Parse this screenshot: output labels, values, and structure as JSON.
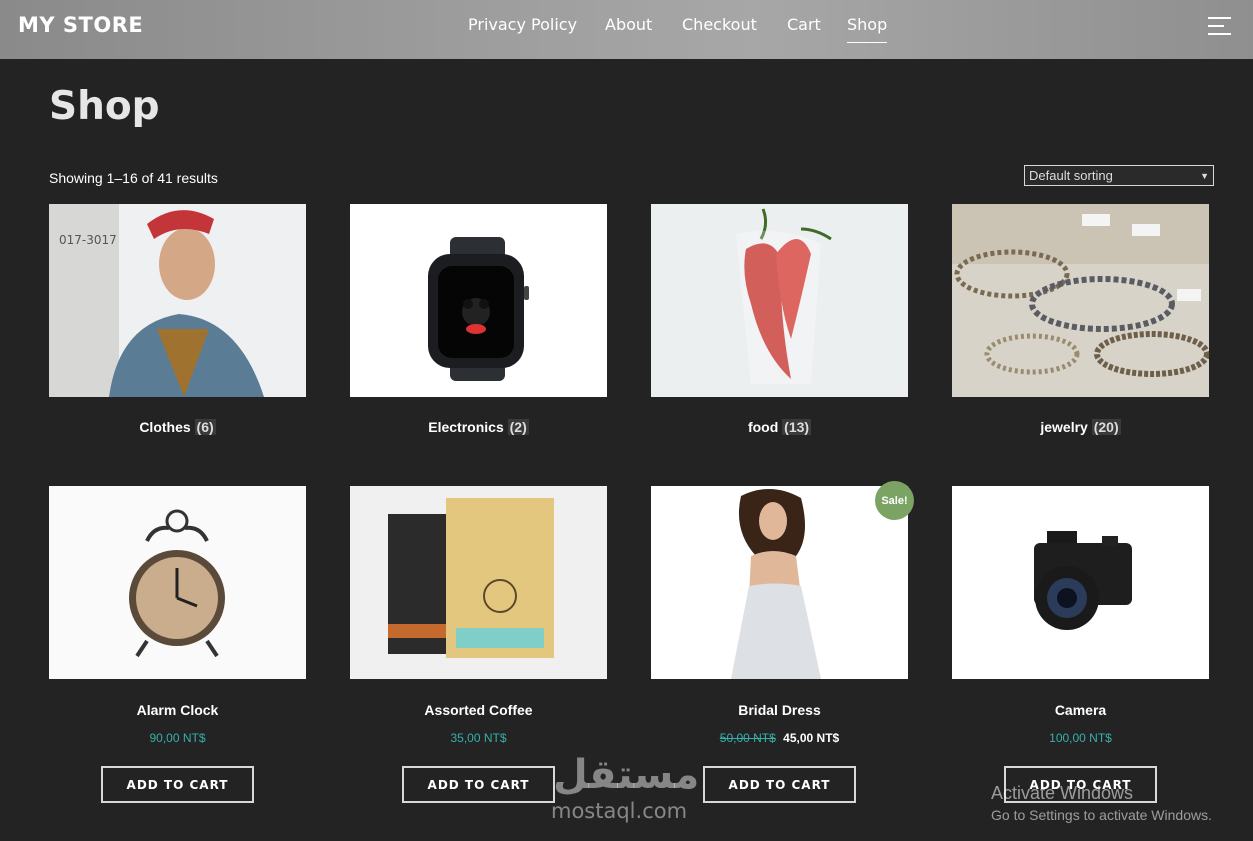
{
  "header": {
    "logo": "MY STORE",
    "nav": [
      "Privacy Policy",
      "About",
      "Checkout",
      "Cart",
      "Shop"
    ],
    "active_nav": "Shop"
  },
  "main": {
    "title": "Shop",
    "result_count": "Showing 1–16 of 41 results",
    "sort_value": "Default sorting"
  },
  "categories": [
    {
      "name": "Clothes",
      "count": "(6)",
      "icon": "man-in-denim-jacket-photo"
    },
    {
      "name": "Electronics",
      "count": "(2)",
      "icon": "smartwatch-photo"
    },
    {
      "name": "food",
      "count": "(13)",
      "icon": "red-chili-peppers-photo"
    },
    {
      "name": "jewelry",
      "count": "(20)",
      "icon": "jewelry-display-photo"
    }
  ],
  "products": [
    {
      "name": "Alarm Clock",
      "price": "90,00 NT$",
      "old_price": "",
      "sale": false,
      "button": "ADD TO CART",
      "icon": "alarm-clock-photo"
    },
    {
      "name": "Assorted Coffee",
      "price": "35,00 NT$",
      "old_price": "",
      "sale": false,
      "button": "ADD TO CART",
      "icon": "coffee-bags-photo"
    },
    {
      "name": "Bridal Dress",
      "price": "45,00 NT$",
      "old_price": "50,00 NT$",
      "sale": true,
      "sale_label": "Sale!",
      "button": "ADD TO CART",
      "icon": "bridal-dress-photo"
    },
    {
      "name": "Camera",
      "price": "100,00 NT$",
      "old_price": "",
      "sale": false,
      "button": "ADD TO CART",
      "icon": "camera-photo"
    }
  ],
  "watermark": {
    "arabic": "مستقل",
    "latin": "mostaql.com"
  },
  "os_overlay": {
    "title": "Activate Windows",
    "subtitle": "Go to Settings to activate Windows."
  },
  "colors": {
    "background": "#232323",
    "price": "#36b0a8",
    "sale_badge": "#7ba464"
  }
}
